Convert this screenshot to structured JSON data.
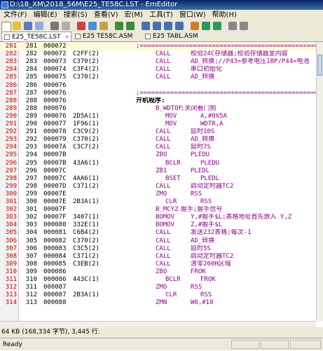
{
  "window": {
    "title": "D:\\18_XM\\2018_56M\\E25_TE58C.LST - EmEditor"
  },
  "menu": [
    "文件(F)",
    "编辑(E)",
    "搜索(S)",
    "查看(V)",
    "宏(M)",
    "工具(T)",
    "窗口(W)",
    "帮助(H)"
  ],
  "tabs": [
    {
      "label": "E25_TE58C.LST",
      "active": true
    },
    {
      "label": "E25 TE58C.ASM",
      "active": false
    },
    {
      "label": "E25 TABL.ASM",
      "active": false
    }
  ],
  "lines": [
    {
      "ln": "281",
      "n": "281",
      "addr": "000072",
      "sep": true
    },
    {
      "ln": "282",
      "n": "282",
      "addr": "000072",
      "code": "C2FF(2)",
      "mn": "CALL",
      "arg": "校验24C存储器;校验存储器里内容"
    },
    {
      "ln": "283",
      "n": "283",
      "addr": "000073",
      "code": "C370(2)",
      "mn": "CALL",
      "arg": "AD_转换;//P43=参考电压1BP/P44=电池"
    },
    {
      "ln": "284",
      "n": "284",
      "addr": "000074",
      "code": "C3F4(2)",
      "mn": "CALL",
      "arg": "串口初始化"
    },
    {
      "ln": "285",
      "n": "285",
      "addr": "000075",
      "code": "C370(2)",
      "mn": "CALL",
      "arg": "AD_转换"
    },
    {
      "ln": "286",
      "n": "286",
      "addr": "000076"
    },
    {
      "ln": "287",
      "n": "287",
      "addr": "000076",
      "sep": true
    },
    {
      "ln": "288",
      "n": "288",
      "addr": "000076",
      "label": "开机程序:"
    },
    {
      "ln": "289",
      "n": "288",
      "addr": "000076",
      "mn": "B_WDTOF",
      "arg": ";关闭看门狗",
      "mnAt": "label"
    },
    {
      "ln": "290",
      "n": "289",
      "addr": "000076",
      "code": "2D5A(1)",
      "mn": "MOV",
      "arg": "A,#0X5A",
      "indent": true
    },
    {
      "ln": "291",
      "n": "290",
      "addr": "000077",
      "code": "1F96(1)",
      "mn": "MOV",
      "arg": "WDTR,A",
      "indent": true
    },
    {
      "ln": "292",
      "n": "291",
      "addr": "000078",
      "code": "C3C9(2)",
      "mn": "CALL",
      "arg": "延时10S"
    },
    {
      "ln": "293",
      "n": "292",
      "addr": "000079",
      "code": "C370(2)",
      "mn": "CALL",
      "arg": "AD_转换"
    },
    {
      "ln": "294",
      "n": "293",
      "addr": "00007A",
      "code": "C3C7(2)",
      "mn": "CALL",
      "arg": "延时7S"
    },
    {
      "ln": "295",
      "n": "294",
      "addr": "00007B",
      "mn": "ZBO",
      "arg": "PLEDU"
    },
    {
      "ln": "296",
      "n": "295",
      "addr": "00007B",
      "code": "43A6(1)",
      "mn": "BCLR",
      "arg": "PLEDU",
      "indent": true
    },
    {
      "ln": "297",
      "n": "296",
      "addr": "00007C",
      "mn": "ZB1",
      "arg": "PLEDL"
    },
    {
      "ln": "298",
      "n": "297",
      "addr": "00007C",
      "code": "4AA6(1)",
      "mn": "BSET",
      "arg": "PLEDL",
      "indent": true
    },
    {
      "ln": "299",
      "n": "298",
      "addr": "00007D",
      "code": "C371(2)",
      "mn": "CALL",
      "arg": "启动定时器TC2"
    },
    {
      "ln": "300",
      "n": "299",
      "addr": "00007E",
      "mn": "ZMO",
      "arg": "RSS"
    },
    {
      "ln": "301",
      "n": "300",
      "addr": "00007E",
      "code": "2B3A(1)",
      "mn": "CLR",
      "arg": "RSS",
      "indent": true
    },
    {
      "ln": "302",
      "n": "301",
      "addr": "00007F",
      "mn": "B_MCYZ",
      "arg": "握手;握手信号",
      "mnAt": "label"
    },
    {
      "ln": "303",
      "n": "302",
      "addr": "00007F",
      "code": "3407(1)",
      "mn": "BOMOV",
      "arg": "Y,#握手$L;表格地址首先放入 Y,Z"
    },
    {
      "ln": "304",
      "n": "303",
      "addr": "000080",
      "code": "332E(1)",
      "mn": "BOMOV",
      "arg": "Z,#握手$L"
    },
    {
      "ln": "305",
      "n": "304",
      "addr": "000081",
      "code": "C6B4(2)",
      "mn": "CALL",
      "arg": "发送232表格;每次-1"
    },
    {
      "ln": "306",
      "n": "305",
      "addr": "000082",
      "code": "C370(2)",
      "mn": "CALL",
      "arg": "AD_转换"
    },
    {
      "ln": "307",
      "n": "306",
      "addr": "000083",
      "code": "C3C5(2)",
      "mn": "CALL",
      "arg": "延时5S"
    },
    {
      "ln": "308",
      "n": "307",
      "addr": "000084",
      "code": "C371(2)",
      "mn": "CALL",
      "arg": "启动定时器TC2"
    },
    {
      "ln": "309",
      "n": "308",
      "addr": "000085",
      "code": "C3EB(2)",
      "mn": "CALL",
      "arg": "清零200H区域"
    },
    {
      "ln": "310",
      "n": "309",
      "addr": "000086",
      "mn": "ZBO",
      "arg": "FROK"
    },
    {
      "ln": "311",
      "n": "310",
      "addr": "000086",
      "code": "443C(1)",
      "mn": "BCLR",
      "arg": "FROK",
      "indent": true
    },
    {
      "ln": "312",
      "n": "311",
      "addr": "000087",
      "mn": "ZMO",
      "arg": "RSS"
    },
    {
      "ln": "313",
      "n": "312",
      "addr": "000087",
      "code": "2B3A(1)",
      "mn": "CLR",
      "arg": "RSS",
      "indent": true
    },
    {
      "ln": "314",
      "n": "313",
      "addr": "000088",
      "mn": "ZMN",
      "arg": "W6,#10"
    }
  ],
  "status": {
    "size_text": "64 KB (168,334 字节), 3,445 行.",
    "ready": "Ready"
  },
  "colors": {
    "linenum": "#c00000",
    "mnemonic": "#8b008b",
    "titlebar": "#0a246a"
  }
}
